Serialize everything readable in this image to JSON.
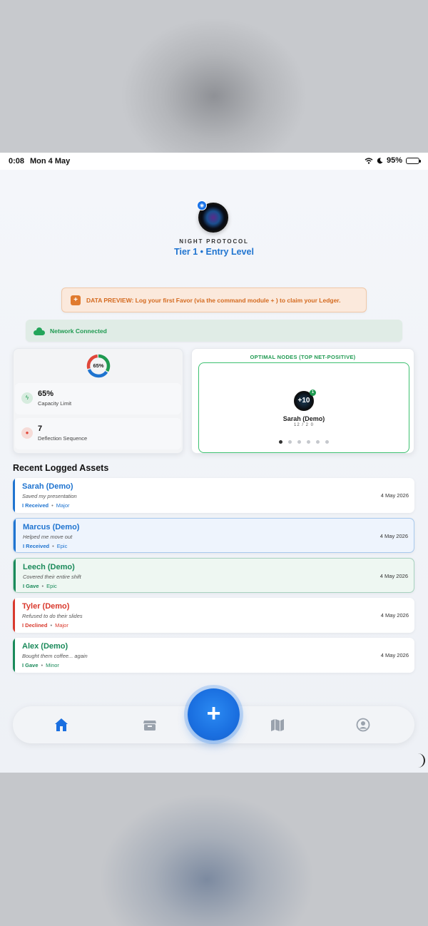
{
  "status_bar": {
    "time": "0:08",
    "date": "Mon 4 May",
    "battery": "95%",
    "battery_level": 0.95
  },
  "brand": {
    "name": "NIGHT PROTOCOL",
    "tier": "Tier 1 • Entry Level"
  },
  "preview_banner": {
    "text": "DATA PREVIEW: Log your first Favor (via the command module + ) to claim your Ledger."
  },
  "network": {
    "text": "Network Connected"
  },
  "stats": {
    "capacity_percent_label": "65%",
    "capacity_fraction": 0.65,
    "capacity_value": "65%",
    "capacity_label": "Capacity Limit",
    "deflection_value": "7",
    "deflection_label": "Deflection Sequence"
  },
  "nodes": {
    "title": "OPTIMAL NODES (TOP NET-POSITIVE)",
    "avatar_text": "+10",
    "badge": "1",
    "name": "Sarah (Demo)",
    "score": "12 / 2 0",
    "page_count": 6,
    "active_page": 1
  },
  "recent": {
    "title": "Recent Logged Assets",
    "items": [
      {
        "name": "Sarah (Demo)",
        "note": "Saved my presentation",
        "direction": "I Received",
        "level": "Major",
        "date": "4 May 2026",
        "color": "#1f74d0",
        "bg": "#ffffff"
      },
      {
        "name": "Marcus (Demo)",
        "note": "Helped me move out",
        "direction": "I Received",
        "level": "Epic",
        "date": "4 May 2026",
        "color": "#1f74d0",
        "bg": "#eef4fd"
      },
      {
        "name": "Leech (Demo)",
        "note": "Covered their entire shift",
        "direction": "I Gave",
        "level": "Epic",
        "date": "4 May 2026",
        "color": "#1a8a5a",
        "bg": "#eef7f2"
      },
      {
        "name": "Tyler (Demo)",
        "note": "Refused to do their slides",
        "direction": "I Declined",
        "level": "Major",
        "date": "4 May 2026",
        "color": "#d93a2e",
        "bg": "#ffffff"
      },
      {
        "name": "Alex (Demo)",
        "note": "Bought them coffee... again",
        "direction": "I Gave",
        "level": "Minor",
        "date": "4 May 2026",
        "color": "#1a8a5a",
        "bg": "#ffffff"
      }
    ]
  },
  "tabbar": {
    "tabs": [
      {
        "icon": "home-icon",
        "active": true
      },
      {
        "icon": "inventory-icon",
        "active": false
      },
      {
        "icon": "map-icon",
        "active": false
      },
      {
        "icon": "profile-icon",
        "active": false
      }
    ],
    "fab_label": "+"
  },
  "colors": {
    "accent": "#1a6fe0",
    "positive": "#1f9a51",
    "warning": "#d46a1f",
    "negative": "#d93a2e"
  }
}
